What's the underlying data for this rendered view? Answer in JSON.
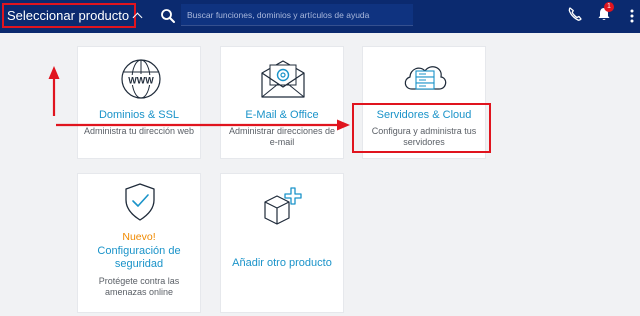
{
  "header": {
    "product_select_label": "Seleccionar producto",
    "search_placeholder": "Buscar funciones, dominios y artículos de ayuda",
    "notification_count": "1"
  },
  "cards": [
    {
      "title": "Dominios & SSL",
      "desc": "Administra tu dirección web",
      "icon": "globe-www-icon"
    },
    {
      "title": "E-Mail & Office",
      "desc": "Administrar direcciones de e-mail",
      "icon": "envelope-at-icon"
    },
    {
      "title": "Servidores & Cloud",
      "desc": "Configura y administra tus servidores",
      "icon": "cloud-server-icon"
    },
    {
      "badge": "Nuevo!",
      "title": "Configuración de seguridad",
      "desc": "Protégete contra las amenazas online",
      "icon": "shield-check-icon"
    },
    {
      "title": "Añadir otro producto",
      "icon": "box-plus-icon"
    }
  ],
  "colors": {
    "topbar": "#0b2a6f",
    "accent_link": "#1a93c9",
    "annotation_red": "#e0141e",
    "new_badge": "#f08a00"
  }
}
